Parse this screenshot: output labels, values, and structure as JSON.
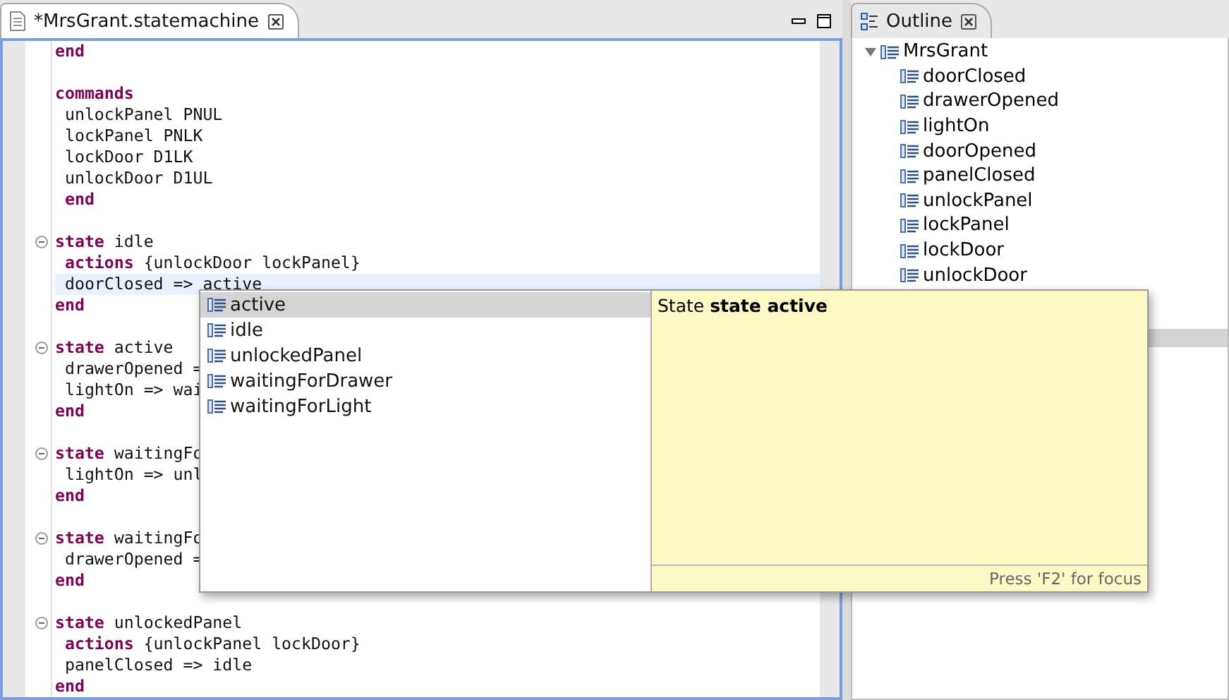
{
  "editor": {
    "tab": {
      "title": "*MrsGrant.statemachine",
      "selected": true
    },
    "lines": [
      {
        "fold": false,
        "current": false,
        "tokens": [
          {
            "kind": "keyword",
            "text": "end"
          }
        ]
      },
      {
        "fold": false,
        "current": false
      },
      {
        "fold": false,
        "current": false,
        "tokens": [
          {
            "kind": "keyword",
            "text": "commands"
          }
        ]
      },
      {
        "fold": false,
        "current": false,
        "tokens": [
          {
            "kind": "plain",
            "text": " unlockPanel PNUL"
          }
        ]
      },
      {
        "fold": false,
        "current": false,
        "tokens": [
          {
            "kind": "plain",
            "text": " lockPanel PNLK"
          }
        ]
      },
      {
        "fold": false,
        "current": false,
        "tokens": [
          {
            "kind": "plain",
            "text": " lockDoor D1LK"
          }
        ]
      },
      {
        "fold": false,
        "current": false,
        "tokens": [
          {
            "kind": "plain",
            "text": " unlockDoor D1UL"
          }
        ]
      },
      {
        "fold": false,
        "current": false,
        "tokens": [
          {
            "kind": "keyword",
            "text": " end"
          }
        ]
      },
      {
        "fold": false,
        "current": false
      },
      {
        "fold": true,
        "current": false,
        "tokens": [
          {
            "kind": "keyword",
            "text": "state"
          },
          {
            "kind": "plain",
            "text": " idle"
          }
        ]
      },
      {
        "fold": false,
        "current": false,
        "tokens": [
          {
            "kind": "keyword",
            "text": " actions"
          },
          {
            "kind": "plain",
            "text": " {unlockDoor lockPanel}"
          }
        ]
      },
      {
        "fold": false,
        "current": true,
        "tokens": [
          {
            "kind": "plain",
            "text": " doorClosed => active"
          }
        ]
      },
      {
        "fold": false,
        "current": false,
        "tokens": [
          {
            "kind": "keyword",
            "text": "end"
          }
        ]
      },
      {
        "fold": false,
        "current": false
      },
      {
        "fold": true,
        "current": false,
        "tokens": [
          {
            "kind": "keyword",
            "text": "state"
          },
          {
            "kind": "plain",
            "text": " active"
          }
        ]
      },
      {
        "fold": false,
        "current": false,
        "tokens": [
          {
            "kind": "plain",
            "text": " drawerOpened ="
          }
        ]
      },
      {
        "fold": false,
        "current": false,
        "tokens": [
          {
            "kind": "plain",
            "text": " lightOn => wai"
          }
        ]
      },
      {
        "fold": false,
        "current": false,
        "tokens": [
          {
            "kind": "keyword",
            "text": "end"
          }
        ]
      },
      {
        "fold": false,
        "current": false
      },
      {
        "fold": true,
        "current": false,
        "tokens": [
          {
            "kind": "keyword",
            "text": "state"
          },
          {
            "kind": "plain",
            "text": " waitingFo"
          }
        ]
      },
      {
        "fold": false,
        "current": false,
        "tokens": [
          {
            "kind": "plain",
            "text": " lightOn => unl"
          }
        ]
      },
      {
        "fold": false,
        "current": false,
        "tokens": [
          {
            "kind": "keyword",
            "text": "end"
          }
        ]
      },
      {
        "fold": false,
        "current": false
      },
      {
        "fold": true,
        "current": false,
        "tokens": [
          {
            "kind": "keyword",
            "text": "state"
          },
          {
            "kind": "plain",
            "text": " waitingFo"
          }
        ]
      },
      {
        "fold": false,
        "current": false,
        "tokens": [
          {
            "kind": "plain",
            "text": " drawerOpened ="
          }
        ]
      },
      {
        "fold": false,
        "current": false,
        "tokens": [
          {
            "kind": "keyword",
            "text": "end"
          }
        ]
      },
      {
        "fold": false,
        "current": false
      },
      {
        "fold": true,
        "current": false,
        "tokens": [
          {
            "kind": "keyword",
            "text": "state"
          },
          {
            "kind": "plain",
            "text": " unlockedPanel"
          }
        ]
      },
      {
        "fold": false,
        "current": false,
        "tokens": [
          {
            "kind": "keyword",
            "text": " actions"
          },
          {
            "kind": "plain",
            "text": " {unlockPanel lockDoor}"
          }
        ]
      },
      {
        "fold": false,
        "current": false,
        "tokens": [
          {
            "kind": "plain",
            "text": " panelClosed => idle"
          }
        ]
      },
      {
        "fold": false,
        "current": false,
        "tokens": [
          {
            "kind": "keyword",
            "text": "end"
          }
        ]
      }
    ]
  },
  "completion": {
    "items": [
      {
        "label": "active",
        "selected": true
      },
      {
        "label": "idle",
        "selected": false
      },
      {
        "label": "unlockedPanel",
        "selected": false
      },
      {
        "label": "waitingForDrawer",
        "selected": false
      },
      {
        "label": "waitingForLight",
        "selected": false
      }
    ],
    "doc": "State **state active**",
    "footer": "Press 'F2' for focus"
  },
  "outline": {
    "tab": {
      "title": "Outline",
      "selected": false
    },
    "tree": [
      {
        "label": "MrsGrant",
        "expanded": true,
        "children": [
          {
            "label": "doorClosed"
          },
          {
            "label": "drawerOpened"
          },
          {
            "label": "lightOn"
          },
          {
            "label": "doorOpened"
          },
          {
            "label": "panelClosed"
          },
          {
            "label": "unlockPanel"
          },
          {
            "label": "lockPanel"
          },
          {
            "label": "lockDoor"
          },
          {
            "label": "unlockDoor"
          }
        ]
      }
    ]
  }
}
